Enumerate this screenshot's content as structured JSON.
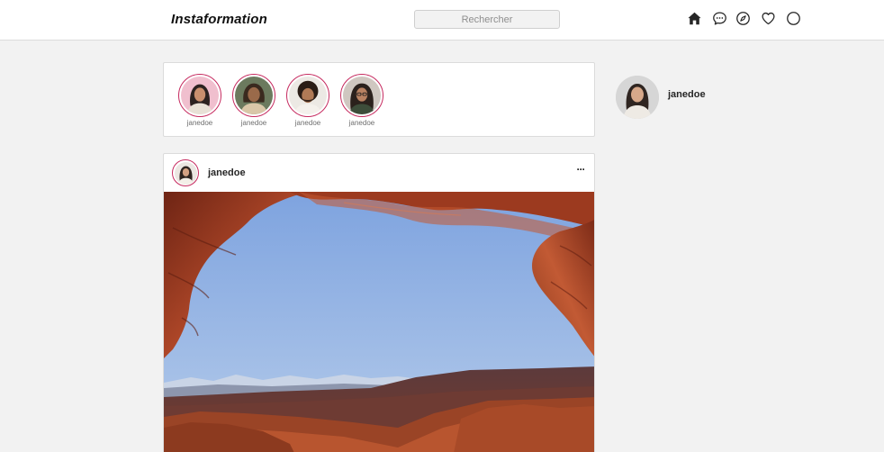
{
  "header": {
    "logo": "Instaformation",
    "search": {
      "placeholder": "Rechercher",
      "value": ""
    },
    "icons": [
      "home-icon",
      "messages-icon",
      "explore-icon",
      "activity-heart-icon",
      "profile-icon"
    ]
  },
  "stories": [
    {
      "username": "janedoe",
      "avatar": "avatar-woman-pink"
    },
    {
      "username": "janedoe",
      "avatar": "avatar-woman-smiling"
    },
    {
      "username": "janedoe",
      "avatar": "avatar-man-curly"
    },
    {
      "username": "janedoe",
      "avatar": "avatar-woman-glasses"
    }
  ],
  "post": {
    "username": "janedoe",
    "more_label": "···",
    "photo": "canyon-arch-landscape"
  },
  "sidebar": {
    "username": "janedoe"
  },
  "colors": {
    "story_ring": "#c62a5f",
    "background": "#f2f2f2",
    "card_border": "#dbdbdb",
    "sky": "#9cb8e6",
    "rock": "#a2482a"
  }
}
